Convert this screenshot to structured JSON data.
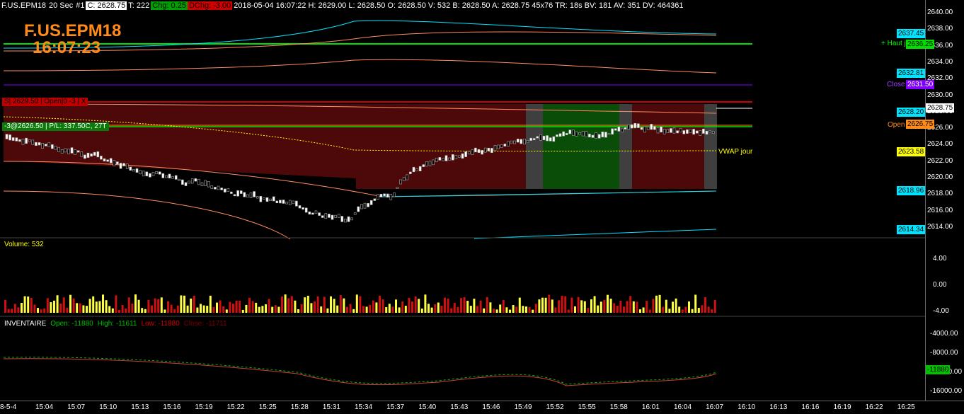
{
  "header": {
    "symbol": "F.US.EPM18",
    "interval": "20 Sec",
    "chart_no": "#1",
    "close": "C: 2628.75",
    "trades": "T: 222",
    "chg": "Chg: 0.25",
    "dchg": "DChg: -3.00",
    "details": "2018-05-04 16:07:22 H: 2629.00 L: 2628.50 O: 2628.50 V: 532 B: 2628.50 A: 2628.75 45x76 TR: 18s BV: 181 AV: 351 DV: 464361"
  },
  "watermark": {
    "symbol": "F.US.EPM18",
    "time": "16:07:23"
  },
  "orders": {
    "stop": "S| 2629.50 | Open|0 -3 | X",
    "position": "-3@2626.50 | P/L: 337.50C, 27T"
  },
  "levels": {
    "haut": "+ Haut j - 1",
    "close": "Close j - 1",
    "open": "Open j - 1",
    "vwap": "VWAP jour"
  },
  "price_tags": {
    "t1": "2637.45",
    "t2": "2636.25",
    "t3": "2632.81",
    "t4": "2631.50",
    "t5": "2628.75",
    "t6": "2628.20",
    "t7": "2626.75",
    "t8": "2623.58",
    "t9": "2618.96",
    "t10": "2614.34",
    "vol_tag": "4",
    "inv_tag": "-11880"
  },
  "price_axis": [
    "2640.00",
    "2638.00",
    "2636.00",
    "2634.00",
    "2632.00",
    "2630.00",
    "2628.00",
    "2626.00",
    "2624.00",
    "2622.00",
    "2620.00",
    "2618.00",
    "2616.00",
    "2614.00"
  ],
  "volume_panel": {
    "label": "Volume: 532",
    "axis": [
      "4.00",
      "0.00",
      "-4.00"
    ]
  },
  "inventory_panel": {
    "label": "INVENTAIRE",
    "open": "Open: -11880",
    "high": "High: -11611",
    "low": "Low: -11880",
    "close": "Close: -11711",
    "axis": [
      "-4000.00",
      "-8000.00",
      "-12000.00",
      "-16000.00"
    ]
  },
  "time_axis": [
    "8-5-4",
    "15:04",
    "15:07",
    "15:10",
    "15:13",
    "15:16",
    "15:19",
    "15:22",
    "15:25",
    "15:28",
    "15:31",
    "15:34",
    "15:37",
    "15:40",
    "15:43",
    "15:46",
    "15:49",
    "15:52",
    "15:55",
    "15:58",
    "16:01",
    "16:04",
    "16:07",
    "16:10",
    "16:13",
    "16:16",
    "16:19",
    "16:22",
    "16:25"
  ],
  "colors": {
    "accent": "#ff8c1a",
    "green": "#00c000",
    "red": "#d00000",
    "cyan": "#00e5ff",
    "purple": "#8000ff",
    "yellow": "#ffff00"
  }
}
